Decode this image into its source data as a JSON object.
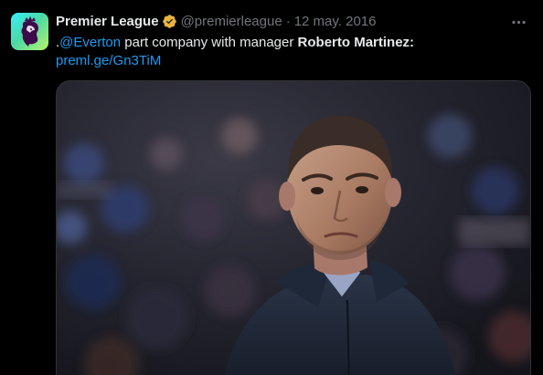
{
  "tweet": {
    "author": {
      "display_name": "Premier League",
      "handle": "@premierleague",
      "separator": "·",
      "date": "12 may. 2016",
      "avatar_icon": "premier-league-lion-logo",
      "verified_icon": "gold-verified-badge"
    },
    "more_icon": "more-dots-icon",
    "text": {
      "prefix": ".",
      "mention": "@Everton",
      "middle": " part company with manager ",
      "bold": "Roberto Martinez",
      "suffix": ":",
      "link": "preml.ge/Gn3TiM"
    },
    "media": {
      "kind": "photo",
      "subject": "man-in-navy-jacket-portrait"
    }
  },
  "colors": {
    "background": "#000000",
    "text": "#e7e9ea",
    "secondary": "#71767b",
    "link": "#1d9bf0",
    "verified": "#e8b341"
  }
}
